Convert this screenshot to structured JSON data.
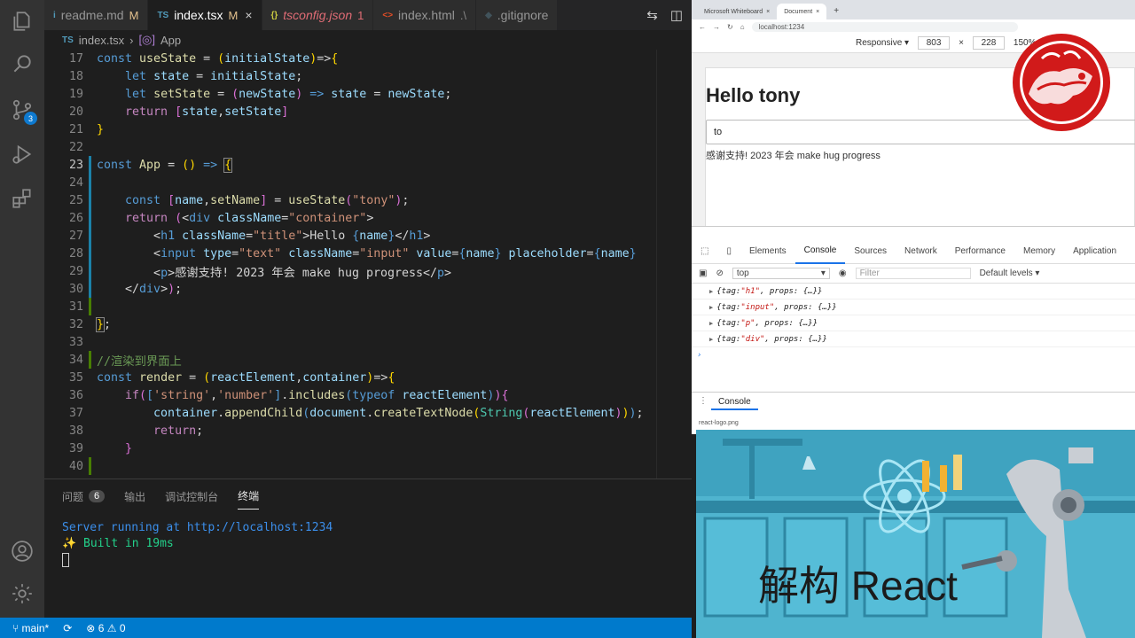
{
  "editor_tabs": [
    {
      "icon": "i",
      "label": "readme.md",
      "status": "M"
    },
    {
      "icon": "TS",
      "label": "index.tsx",
      "status": "M",
      "close": "×"
    },
    {
      "icon": "{}",
      "label": "tsconfig.json",
      "status": "1"
    },
    {
      "icon": "<>",
      "label": "index.html",
      "status": ".\\"
    },
    {
      "icon": "◆",
      "label": ".gitignore",
      "status": ""
    }
  ],
  "breadcrumb": {
    "file": "index.tsx",
    "file_icon": "TS",
    "symbol": "App"
  },
  "code_lines": [
    {
      "n": "17",
      "text": "const useState = (initialState)=>{"
    },
    {
      "n": "18",
      "text": "    let state = initialState;"
    },
    {
      "n": "19",
      "text": "    let setState = (newState) => state = newState;"
    },
    {
      "n": "20",
      "text": "    return [state,setState]"
    },
    {
      "n": "21",
      "text": "}"
    },
    {
      "n": "22",
      "text": ""
    },
    {
      "n": "23",
      "text": "const App = () => {"
    },
    {
      "n": "24",
      "text": ""
    },
    {
      "n": "25",
      "text": "    const [name,setName] = useState(\"tony\");"
    },
    {
      "n": "26",
      "text": "    return (<div className=\"container\">"
    },
    {
      "n": "27",
      "text": "        <h1 className=\"title\">Hello {name}</h1>"
    },
    {
      "n": "28",
      "text": "        <input type=\"text\" className=\"input\" value={name} placeholder={name}"
    },
    {
      "n": "29",
      "text": "        <p>感谢支持! 2023 年会 make hug progress</p>"
    },
    {
      "n": "30",
      "text": "    </div>);"
    },
    {
      "n": "31",
      "text": ""
    },
    {
      "n": "32",
      "text": "};"
    },
    {
      "n": "33",
      "text": ""
    },
    {
      "n": "34",
      "text": "//渲染到界面上"
    },
    {
      "n": "35",
      "text": "const render = (reactElement,container)=>{"
    },
    {
      "n": "36",
      "text": "    if(['string','number'].includes(typeof reactElement)){"
    },
    {
      "n": "37",
      "text": "        container.appendChild(document.createTextNode(String(reactElement)));"
    },
    {
      "n": "38",
      "text": "        return;"
    },
    {
      "n": "39",
      "text": "    }"
    },
    {
      "n": "40",
      "text": ""
    }
  ],
  "panel": {
    "tabs": [
      {
        "label": "问题",
        "badge": "6"
      },
      {
        "label": "输出"
      },
      {
        "label": "调试控制台"
      },
      {
        "label": "终端"
      }
    ],
    "terminal": {
      "line1": "Server running at http://localhost:1234",
      "line2": "✨ Built in 19ms"
    }
  },
  "statusbar": {
    "branch": "main*",
    "errors": "6",
    "warnings": "0"
  },
  "browser": {
    "tabs": [
      "Microsoft Whiteboard",
      "Document"
    ],
    "url": "localhost:1234",
    "device": {
      "mode": "Responsive",
      "width": "803",
      "height": "228",
      "zoom": "150%"
    },
    "page": {
      "title": "Hello tony",
      "input_value": "to",
      "paragraph": "感谢支持! 2023 年会 make hug progress"
    }
  },
  "devtools": {
    "tabs": [
      "Elements",
      "Console",
      "Sources",
      "Network",
      "Performance",
      "Memory",
      "Application"
    ],
    "context": "top",
    "filter_placeholder": "Filter",
    "levels": "Default levels",
    "logs": [
      {
        "tag": "\"h1\"",
        "rest": ", props: {…}}"
      },
      {
        "tag": "\"input\"",
        "rest": ", props: {…}}"
      },
      {
        "tag": "\"p\"",
        "rest": ", props: {…}}"
      },
      {
        "tag": "\"div\"",
        "rest": ", props: {…}}"
      }
    ],
    "drawer_tab": "Console",
    "drawer_file": "react-logo.png"
  },
  "promo": {
    "title": "解构 React"
  },
  "colors": {
    "accent": "#007acc",
    "seal": "#d11a1a",
    "promo_bg": "#3fa3c0"
  }
}
